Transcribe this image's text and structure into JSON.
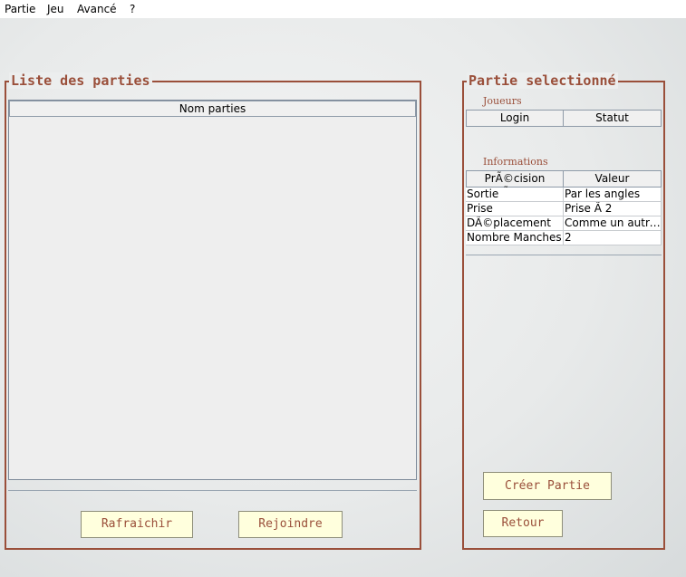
{
  "menu": {
    "items": [
      "Partie",
      "Jeu",
      "Avancé",
      "?"
    ]
  },
  "left_panel": {
    "title": "Liste des parties",
    "table": {
      "header": "Nom parties",
      "rows": []
    },
    "refresh_label": "Rafraichir",
    "join_label": "Rejoindre"
  },
  "right_panel": {
    "title": "Partie selectionné",
    "players": {
      "title": "Joueurs",
      "columns": [
        "Login",
        "Statut"
      ]
    },
    "info": {
      "title": "Informations",
      "columns": [
        "PrÃ©cision rÃ¨gle",
        "Valeur"
      ],
      "rows": [
        [
          "Sortie",
          "Par les angles"
        ],
        [
          "Prise",
          "Prise Ã  2"
        ],
        [
          "DÃ©placement",
          "Comme un autre ..."
        ],
        [
          "Nombre Manches",
          "2"
        ]
      ]
    },
    "create_label": "Créer Partie",
    "back_label": "Retour"
  },
  "colors": {
    "accent": "#9a4f3a",
    "button_bg": "#ffffdd"
  }
}
